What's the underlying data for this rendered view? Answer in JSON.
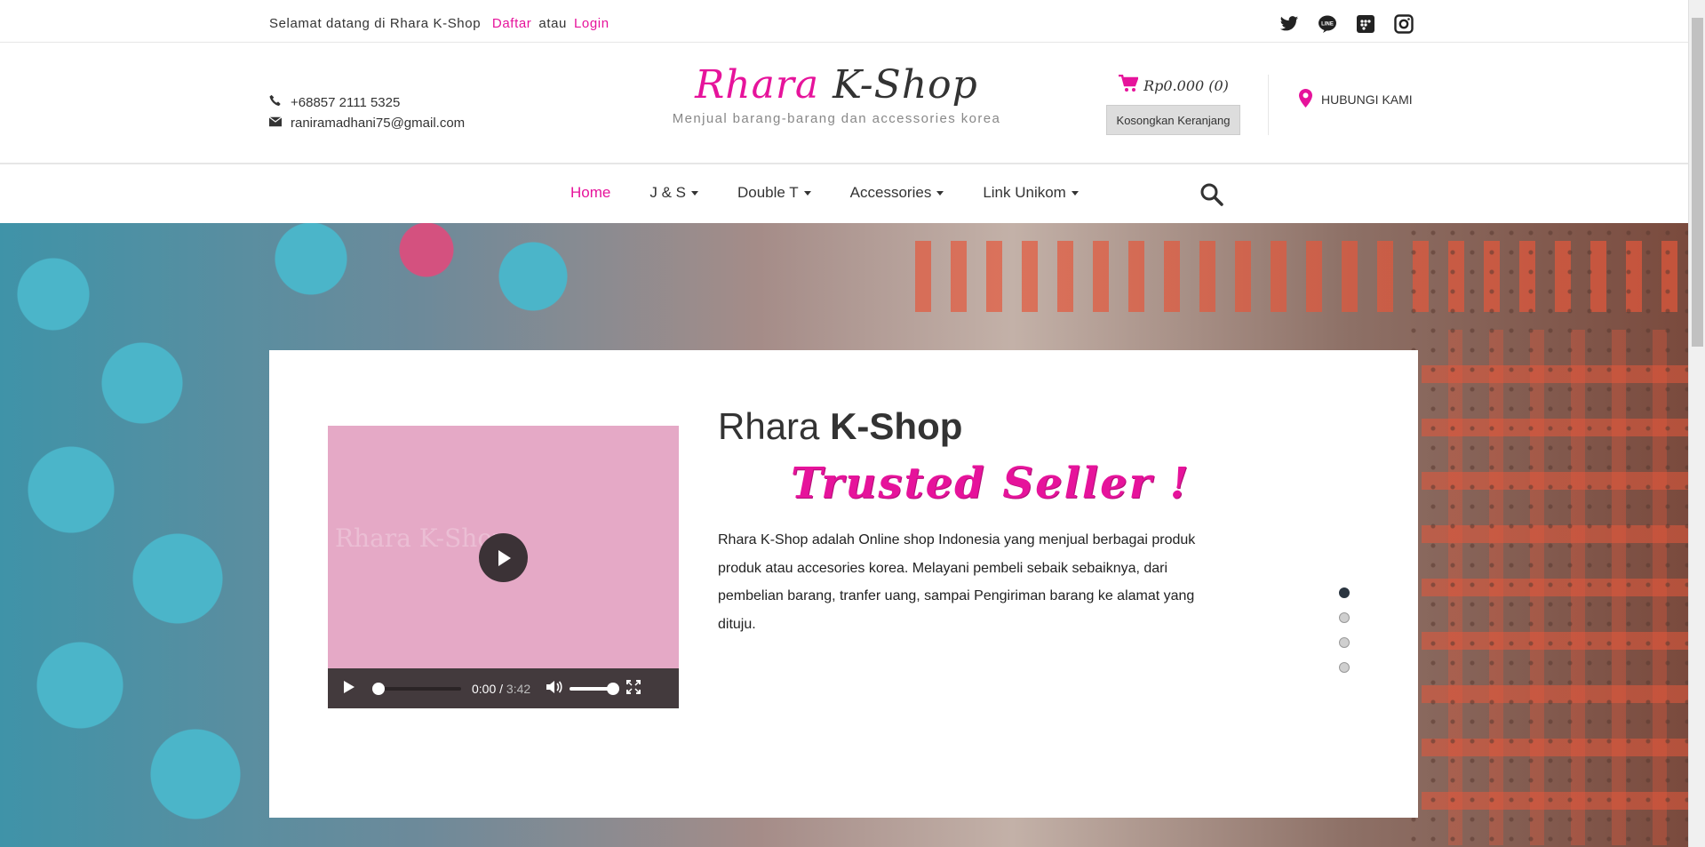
{
  "topbar": {
    "welcome": "Selamat datang di Rhara K-Shop",
    "register": "Daftar",
    "or": "atau",
    "login": "Login",
    "social": [
      "twitter-icon",
      "line-icon",
      "bbm-icon",
      "instagram-icon"
    ]
  },
  "header": {
    "phone": "+68857 2111 5325",
    "email": "raniramadhani75@gmail.com",
    "logo_pink": "Rhara",
    "logo_dark": "K-Shop",
    "tagline": "Menjual barang-barang dan accessories korea",
    "cart_total": "Rp0.000 (0)",
    "empty_cart": "Kosongkan Keranjang",
    "contact_us": "HUBUNGI KAMI"
  },
  "nav": {
    "items": [
      {
        "label": "Home",
        "active": true
      },
      {
        "label": "J & S"
      },
      {
        "label": "Double T"
      },
      {
        "label": "Accessories"
      },
      {
        "label": "Link Unikom"
      }
    ]
  },
  "hero": {
    "title_light": "Rhara",
    "title_bold": "K-Shop",
    "trusted": "Trusted Seller !",
    "description": "Rhara K-Shop adalah Online shop Indonesia yang menjual berbagai produk produk atau accesories korea. Melayani pembeli sebaik sebaiknya, dari pembelian barang, tranfer uang, sampai Pengiriman barang ke alamat yang dituju.",
    "video_watermark": "Rhara K-Shop",
    "video_time": "0:00",
    "video_duration": "3:42",
    "slide_count": 4,
    "active_slide": 1
  },
  "colors": {
    "accent": "#e6139b",
    "dark": "#333333",
    "video_bg": "#e5a9c6"
  }
}
